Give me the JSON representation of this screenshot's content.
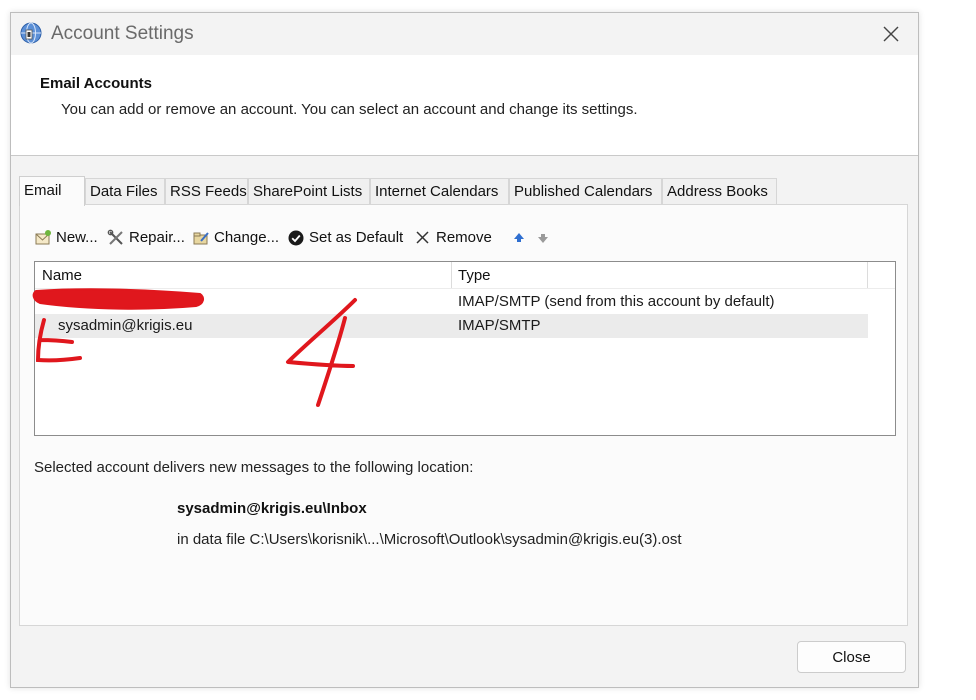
{
  "window": {
    "title": "Account Settings",
    "close_icon": "close-icon"
  },
  "header": {
    "title": "Email Accounts",
    "description": "You can add or remove an account. You can select an account and change its settings."
  },
  "tabs": [
    {
      "label": "Email",
      "active": true
    },
    {
      "label": "Data Files"
    },
    {
      "label": "RSS Feeds"
    },
    {
      "label": "SharePoint Lists"
    },
    {
      "label": "Internet Calendars"
    },
    {
      "label": "Published Calendars"
    },
    {
      "label": "Address Books"
    }
  ],
  "toolbar": {
    "new_label": "New...",
    "repair_label": "Repair...",
    "change_label": "Change...",
    "set_default_label": "Set as Default",
    "remove_label": "Remove",
    "icons": [
      "new-mail-icon",
      "repair-tools-icon",
      "change-folder-icon",
      "check-circle-icon",
      "x-remove-icon",
      "arrow-up-icon",
      "arrow-down-icon"
    ]
  },
  "accounts_table": {
    "columns": [
      "Name",
      "Type"
    ],
    "rows": [
      {
        "name": "",
        "type": "IMAP/SMTP (send from this account by default)"
      },
      {
        "name": "sysadmin@krigis.eu",
        "type": "IMAP/SMTP",
        "selected": true
      }
    ]
  },
  "delivery": {
    "intro": "Selected account delivers new messages to the following location:",
    "inbox": "sysadmin@krigis.eu\\Inbox",
    "data_file": "in data file C:\\Users\\korisnik\\...\\Microsoft\\Outlook\\sysadmin@krigis.eu(3).ost"
  },
  "buttons": {
    "close_label": "Close"
  },
  "annotation": {
    "color": "#e0171d",
    "handwritten_number": "4"
  }
}
